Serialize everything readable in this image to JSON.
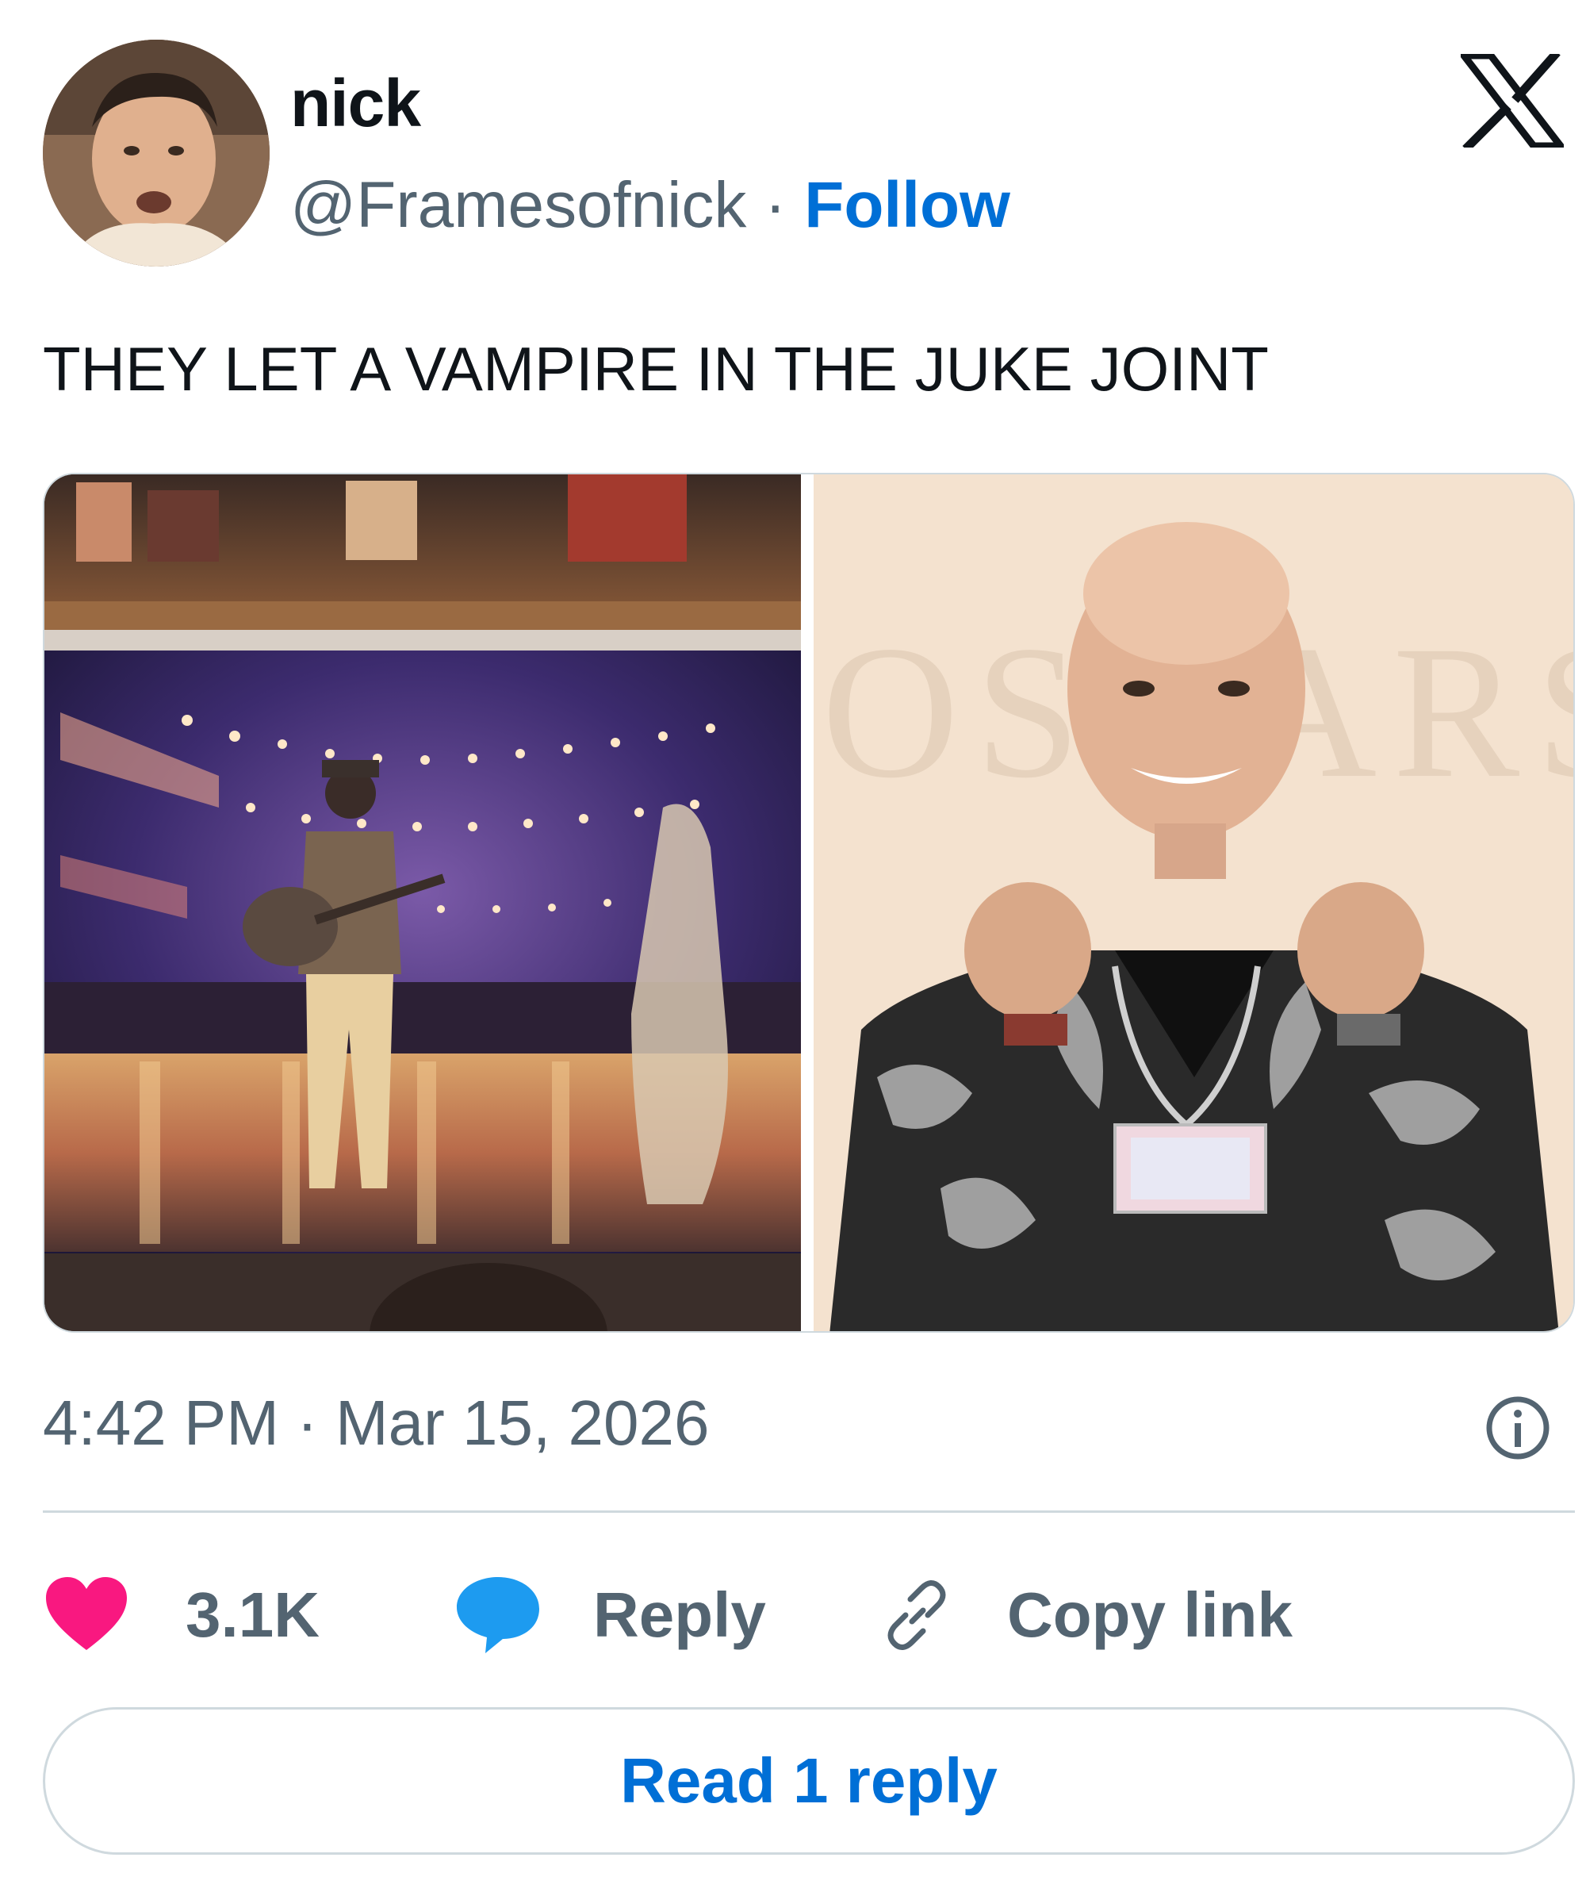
{
  "author": {
    "name": "nick",
    "handle": "@Framesofnick",
    "separator": " · ",
    "follow_label": "Follow"
  },
  "tweet": {
    "text": "THEY LET A VAMPIRE IN THE JUKE JOINT"
  },
  "media": {
    "backdrop_text": "OSCARS"
  },
  "meta": {
    "time": "4:42 PM",
    "separator": " · ",
    "date": "Mar 15, 2026"
  },
  "actions": {
    "like_count": "3.1K",
    "reply_label": "Reply",
    "copy_link_label": "Copy link"
  },
  "read_replies_label": "Read 1 reply",
  "icons": {
    "brand": "x-logo",
    "info": "info-icon",
    "like": "heart-icon",
    "reply": "speech-bubble-icon",
    "link": "link-icon"
  },
  "colors": {
    "like": "#f91880",
    "reply_icon": "#1d9bf0",
    "link": "#006fd6",
    "secondary_text": "#536471",
    "divider": "#cfd9de"
  }
}
